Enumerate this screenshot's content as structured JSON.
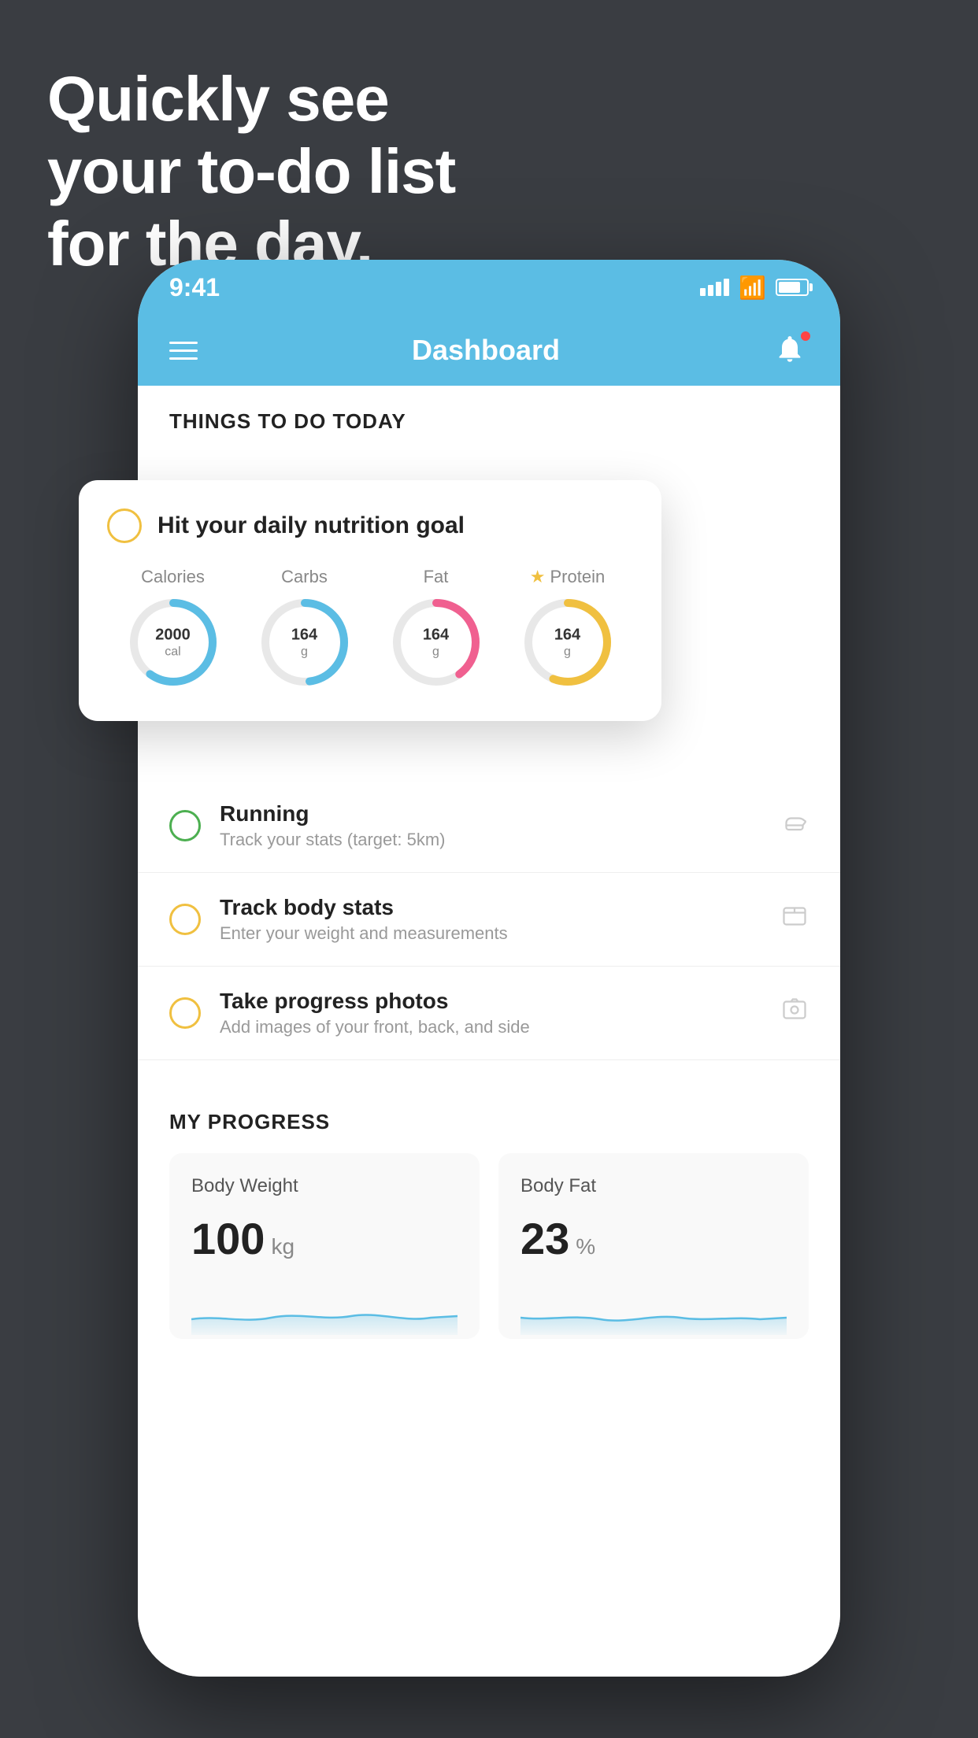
{
  "headline": {
    "line1": "Quickly see",
    "line2": "your to-do list",
    "line3": "for the day."
  },
  "status_bar": {
    "time": "9:41",
    "signal": "signal-icon",
    "wifi": "wifi-icon",
    "battery": "battery-icon"
  },
  "nav": {
    "title": "Dashboard",
    "menu_icon": "hamburger-icon",
    "notification_icon": "bell-icon"
  },
  "things_section": {
    "title": "THINGS TO DO TODAY"
  },
  "nutrition_card": {
    "title": "Hit your daily nutrition goal",
    "stats": [
      {
        "label": "Calories",
        "value": "2000",
        "unit": "cal",
        "color": "blue"
      },
      {
        "label": "Carbs",
        "value": "164",
        "unit": "g",
        "color": "blue"
      },
      {
        "label": "Fat",
        "value": "164",
        "unit": "g",
        "color": "pink"
      },
      {
        "label": "Protein",
        "value": "164",
        "unit": "g",
        "color": "gold",
        "star": true
      }
    ]
  },
  "todo_items": [
    {
      "name": "Running",
      "desc": "Track your stats (target: 5km)",
      "circle_color": "green",
      "icon": "shoe-icon"
    },
    {
      "name": "Track body stats",
      "desc": "Enter your weight and measurements",
      "circle_color": "yellow",
      "icon": "scale-icon"
    },
    {
      "name": "Take progress photos",
      "desc": "Add images of your front, back, and side",
      "circle_color": "yellow",
      "icon": "photo-icon"
    }
  ],
  "progress_section": {
    "title": "MY PROGRESS",
    "cards": [
      {
        "title": "Body Weight",
        "value": "100",
        "unit": "kg"
      },
      {
        "title": "Body Fat",
        "value": "23",
        "unit": "%"
      }
    ]
  }
}
